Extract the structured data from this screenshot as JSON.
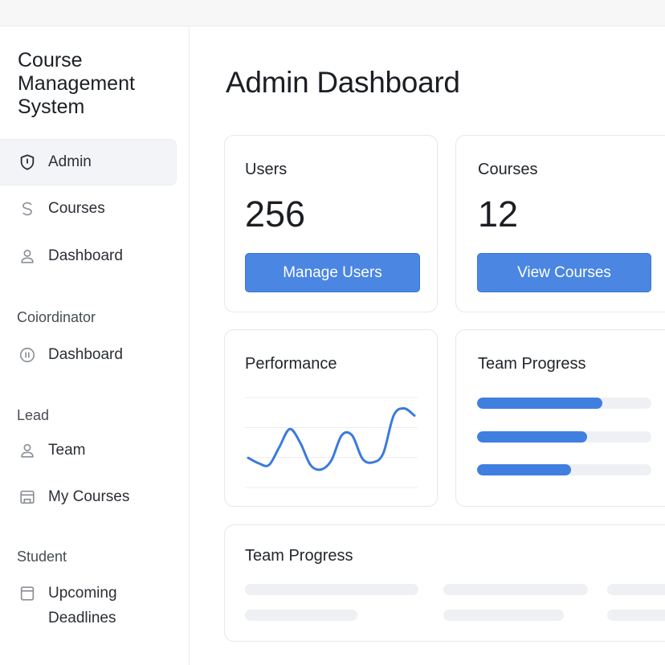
{
  "sidebar": {
    "title": "Course Management System",
    "admin_items": [
      {
        "label": "Admin",
        "icon": "shield-icon",
        "active": true
      },
      {
        "label": "Courses",
        "icon": "curved-s-icon"
      },
      {
        "label": "Dashboard",
        "icon": "user-icon"
      }
    ],
    "coordinator": {
      "heading": "Coiordinator",
      "items": [
        {
          "label": "Dashboard",
          "icon": "pause-circle-icon"
        }
      ]
    },
    "lead": {
      "heading": "Lead",
      "items": [
        {
          "label": "Team",
          "icon": "user-icon"
        },
        {
          "label": "My Courses",
          "icon": "folder-icon"
        }
      ]
    },
    "student": {
      "heading": "Student",
      "items": [
        {
          "label": "Upcoming Deadlines",
          "icon": "calendar-icon"
        }
      ]
    }
  },
  "main": {
    "title": "Admin Dashboard",
    "users_card": {
      "label": "Users",
      "value": "256",
      "button_label": "Manage Users"
    },
    "courses_card": {
      "label": "Courses",
      "value": "12",
      "button_label": "View Courses"
    },
    "performance_card": {
      "label": "Performance"
    },
    "team_progress_card": {
      "label": "Team Progress",
      "progress": [
        0.72,
        0.63,
        0.54
      ]
    },
    "team_progress_table": {
      "label": "Team Progress"
    }
  },
  "colors": {
    "accent": "#4a86e2",
    "progress": "#3f7fe0",
    "chart_line": "#3a7bdc",
    "skeleton": "#eef0f3"
  },
  "chart_data": {
    "type": "line",
    "title": "",
    "xlabel": "",
    "ylabel": "",
    "x": [
      0,
      1,
      2,
      3,
      4,
      5,
      6,
      7,
      8,
      9,
      10,
      11,
      12,
      13,
      14,
      15,
      16
    ],
    "values": [
      33,
      27,
      25,
      45,
      65,
      50,
      25,
      20,
      30,
      58,
      58,
      32,
      28,
      38,
      80,
      88,
      80
    ],
    "ylim": [
      0,
      100
    ],
    "grid": true,
    "legend": "none"
  }
}
